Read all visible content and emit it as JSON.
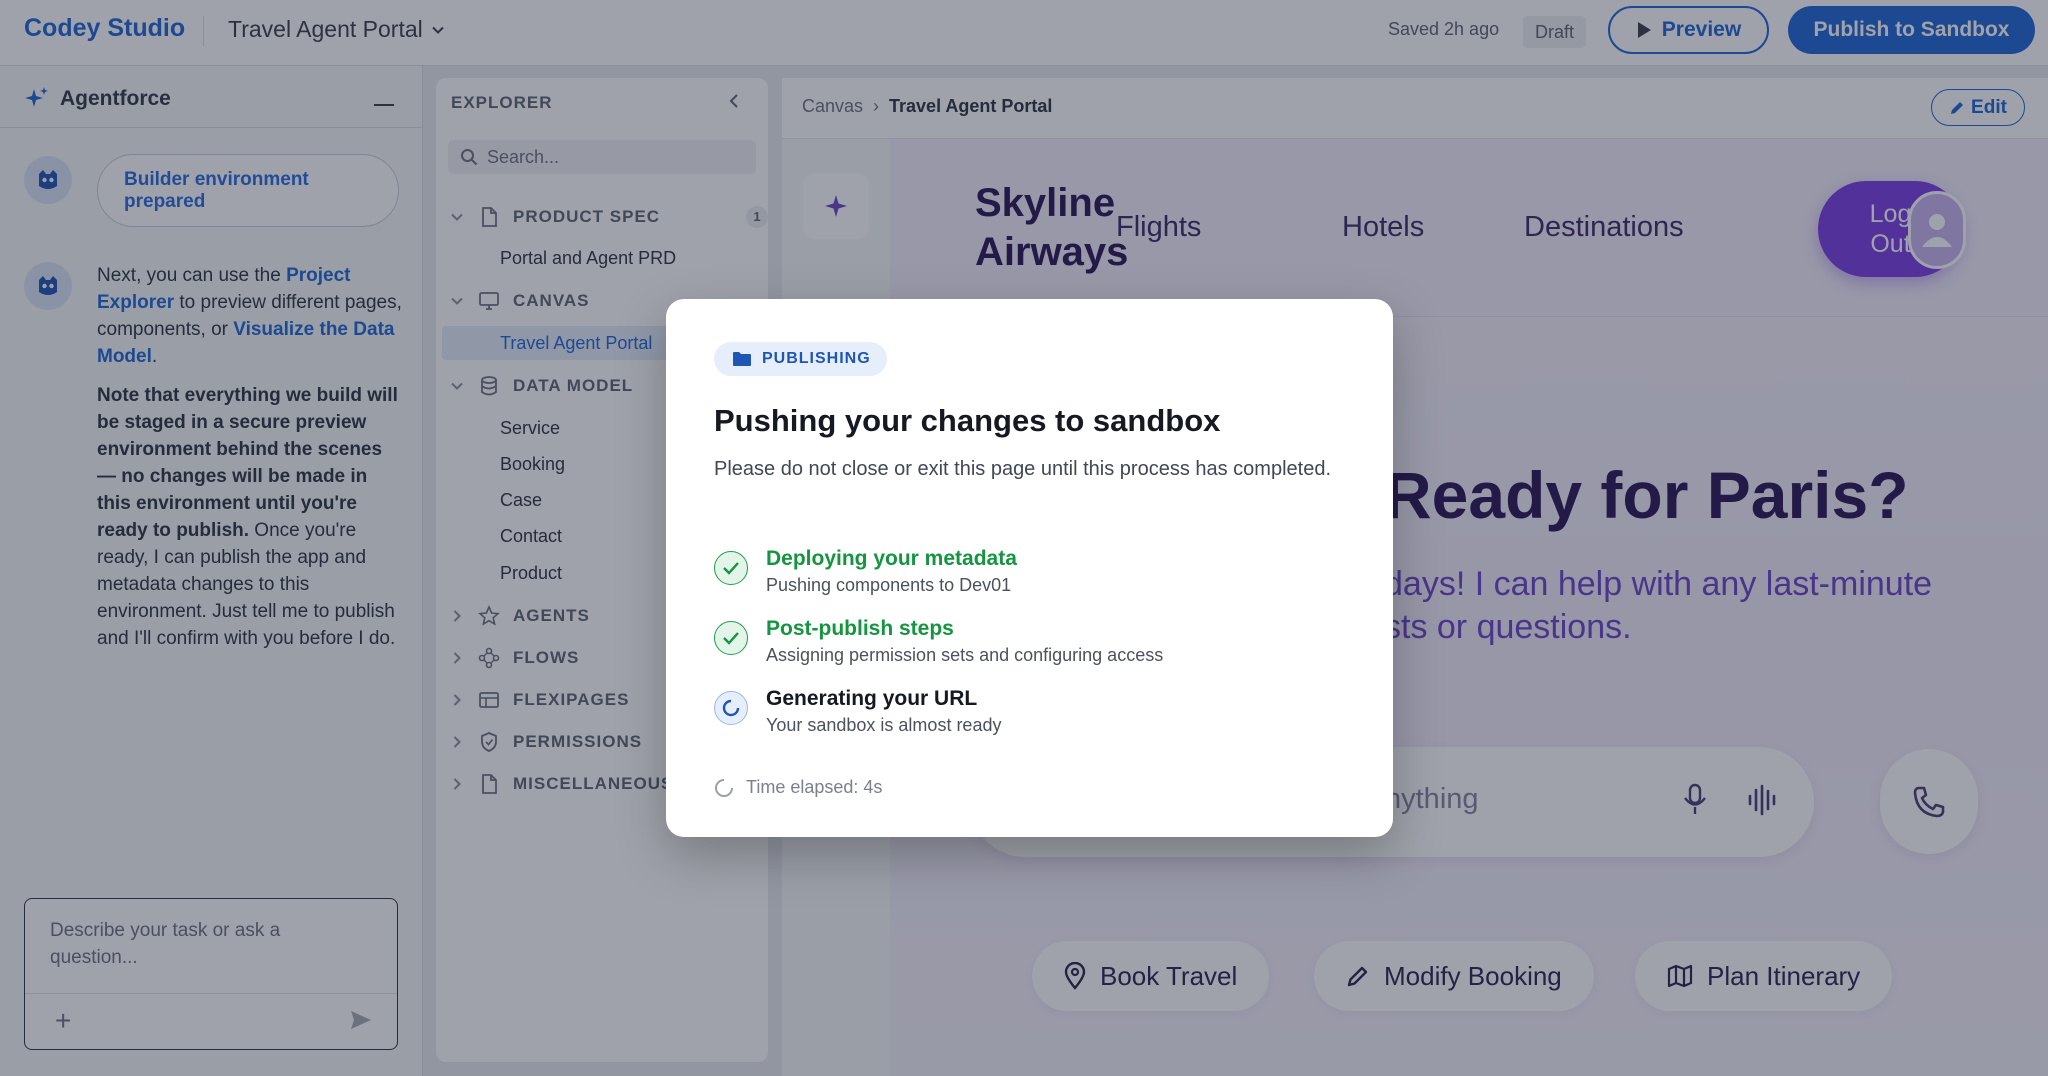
{
  "header": {
    "brand": "Codey Studio",
    "project_name": "Travel Agent Portal",
    "saved_text": "Saved 2h ago",
    "status_badge": "Draft",
    "preview_label": "Preview",
    "publish_label": "Publish to Sandbox",
    "accent_color": "#1f67d6"
  },
  "chat": {
    "title": "Agentforce",
    "pill_message": "Builder environment prepared",
    "msg_part1": "Next, you can use the ",
    "msg_link1": "Project Explorer",
    "msg_part2": " to preview different pages, components, or ",
    "msg_link2": "Visualize the Data Model",
    "msg_part3": ".",
    "msg_bold": "Note that everything we build will be staged in a secure preview environment behind the scenes — no changes will be made in this environment until you're ready to publish.",
    "msg_rest": " Once you're ready, I can publish the app and metadata changes to this environment. Just tell me to publish and I'll confirm with you before I do.",
    "input_placeholder": "Describe your task or ask a question...",
    "add_icon": "plus-icon",
    "send_icon": "send-icon"
  },
  "explorer": {
    "title": "EXPLORER",
    "search_placeholder": "Search...",
    "sections": {
      "product_spec": {
        "label": "PRODUCT SPEC",
        "count": "1",
        "items": [
          "Portal and Agent PRD"
        ]
      },
      "canvas": {
        "label": "CANVAS",
        "items": [
          "Travel Agent Portal"
        ]
      },
      "data_model": {
        "label": "DATA MODEL",
        "items": [
          "Service",
          "Booking",
          "Case",
          "Contact",
          "Product"
        ]
      },
      "agents": {
        "label": "AGENTS"
      },
      "flows": {
        "label": "FLOWS"
      },
      "flexipages": {
        "label": "FLEXIPAGES"
      },
      "permissions": {
        "label": "PERMISSIONS"
      },
      "misc": {
        "label": "MISCELLANEOUS"
      }
    }
  },
  "canvas": {
    "breadcrumb_root": "Canvas",
    "breadcrumb_current": "Travel Agent Portal",
    "edit_label": "Edit",
    "site": {
      "logo_line1": "Skyline",
      "logo_line2": "Airways",
      "nav": [
        "Flights",
        "Hotels",
        "Destinations"
      ],
      "logout_line1": "Log",
      "logout_line2": "Out",
      "hero_title": "Ready for Paris?",
      "hero_sub_line1": "days! I can help with any last-minute",
      "hero_sub_line2": "sts or questions.",
      "ask_placeholder": "nything",
      "chips": [
        "Book Travel",
        "Modify Booking",
        "Plan Itinerary"
      ],
      "brand_purple": "#7b3fe4"
    }
  },
  "modal": {
    "badge": "PUBLISHING",
    "title": "Pushing your changes to sandbox",
    "description": "Please do not close or exit this page until this process has completed.",
    "steps": [
      {
        "title": "Deploying your metadata",
        "subtitle": "Pushing components to Dev01",
        "status": "done"
      },
      {
        "title": "Post-publish steps",
        "subtitle": "Assigning permission sets and configuring access",
        "status": "done"
      },
      {
        "title": "Generating your URL",
        "subtitle": "Your sandbox is almost ready",
        "status": "in-progress"
      }
    ],
    "elapsed": "Time elapsed: 4s",
    "success_color": "#13963f"
  }
}
